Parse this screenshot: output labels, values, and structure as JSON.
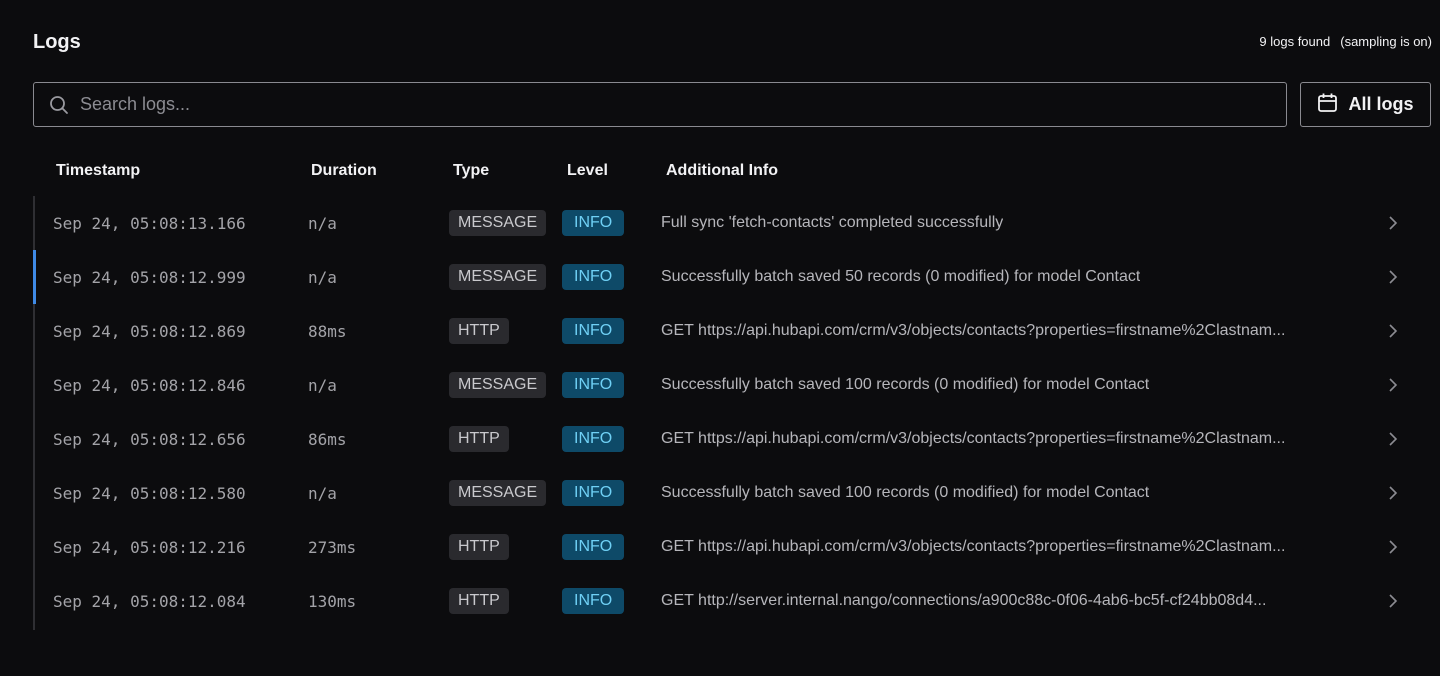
{
  "header": {
    "title": "Logs",
    "count_text": "9 logs found",
    "sampling_text": "(sampling is on)"
  },
  "search": {
    "placeholder": "Search logs...",
    "value": ""
  },
  "filter": {
    "label": "All logs"
  },
  "table": {
    "columns": [
      "Timestamp",
      "Duration",
      "Type",
      "Level",
      "Additional Info"
    ],
    "rows": [
      {
        "timestamp": "Sep 24, 05:08:13.166",
        "duration": "n/a",
        "type": "MESSAGE",
        "level": "INFO",
        "info": "Full sync 'fetch-contacts' completed successfully"
      },
      {
        "timestamp": "Sep 24, 05:08:12.999",
        "duration": "n/a",
        "type": "MESSAGE",
        "level": "INFO",
        "info": "Successfully batch saved 50 records (0 modified) for model Contact"
      },
      {
        "timestamp": "Sep 24, 05:08:12.869",
        "duration": "88ms",
        "type": "HTTP",
        "level": "INFO",
        "info": "GET https://api.hubapi.com/crm/v3/objects/contacts?properties=firstname%2Clastnam..."
      },
      {
        "timestamp": "Sep 24, 05:08:12.846",
        "duration": "n/a",
        "type": "MESSAGE",
        "level": "INFO",
        "info": "Successfully batch saved 100 records (0 modified) for model Contact"
      },
      {
        "timestamp": "Sep 24, 05:08:12.656",
        "duration": "86ms",
        "type": "HTTP",
        "level": "INFO",
        "info": "GET https://api.hubapi.com/crm/v3/objects/contacts?properties=firstname%2Clastnam..."
      },
      {
        "timestamp": "Sep 24, 05:08:12.580",
        "duration": "n/a",
        "type": "MESSAGE",
        "level": "INFO",
        "info": "Successfully batch saved 100 records (0 modified) for model Contact"
      },
      {
        "timestamp": "Sep 24, 05:08:12.216",
        "duration": "273ms",
        "type": "HTTP",
        "level": "INFO",
        "info": "GET https://api.hubapi.com/crm/v3/objects/contacts?properties=firstname%2Clastnam..."
      },
      {
        "timestamp": "Sep 24, 05:08:12.084",
        "duration": "130ms",
        "type": "HTTP",
        "level": "INFO",
        "info": "GET http://server.internal.nango/connections/a900c88c-0f06-4ab6-bc5f-cf24bb08d4..."
      }
    ]
  },
  "colors": {
    "background": "#0c0c0e",
    "level_badge_bg": "#0e4a68",
    "level_badge_text": "#6fd0f5",
    "type_badge_bg": "#2a2a2e",
    "active_row_accent": "#3f8ae5"
  },
  "icons": {
    "search": "search-icon",
    "filter": "calendar-icon",
    "row_open": "chevron-right-icon"
  }
}
